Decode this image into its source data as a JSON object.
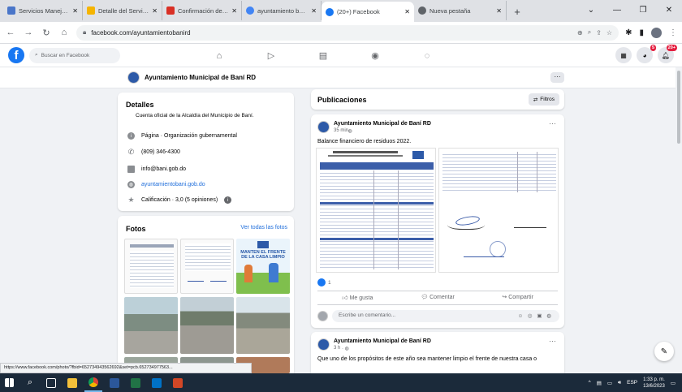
{
  "browser": {
    "tabs": [
      {
        "title": "Servicios Manejo Resi",
        "favicon_color": "#4a76c9"
      },
      {
        "title": "Detalle del Servicio y",
        "favicon_color": "#f5b400"
      },
      {
        "title": "Confirmación de carg",
        "favicon_color": "#d93025"
      },
      {
        "title": "ayuntamiento bani - Busc",
        "favicon_color": "#4285f4"
      },
      {
        "title": "(20+) Facebook",
        "favicon_color": "#1877f2"
      },
      {
        "title": "Nueva pestaña",
        "favicon_color": "#5f6368"
      }
    ],
    "new_tab": "+",
    "url": "facebook.com/ayuntamientobanird",
    "status_url": "https://www.facebook.com/photo/?fbid=652734943562692&set=pcb.652734977563..."
  },
  "fb": {
    "search_placeholder": "Buscar en Facebook",
    "notifications_badge": "5",
    "messages_badge": "20+"
  },
  "page": {
    "name": "Ayuntamiento Municipal de Baní RD"
  },
  "details": {
    "title": "Detalles",
    "description": "Cuenta oficial de la Alcaldía del Municipio de Baní.",
    "category": "Página · Organización gubernamental",
    "phone": "(809) 346-4300",
    "email": "info@bani.gob.do",
    "website": "ayuntamientobani.gob.do",
    "rating": "Calificación · 3,0 (5 opiniones)"
  },
  "photos": {
    "title": "Fotos",
    "see_all": "Ver todas las fotos",
    "poster_text": "MANTEN EL FRENTE DE LA CASA LIMPIO"
  },
  "posts_section": {
    "title": "Publicaciones",
    "filters": "Filtros"
  },
  "post1": {
    "author": "Ayuntamiento Municipal de Baní RD",
    "time": "35 min",
    "text": "Balance financiero de residuos 2022.",
    "reactions": "1",
    "like": "Me gusta",
    "comment": "Comentar",
    "share": "Compartir",
    "comment_placeholder": "Escribe un comentario..."
  },
  "post2": {
    "author": "Ayuntamiento Municipal de Baní RD",
    "time": "3 h",
    "text": "Que uno de los propósitos de este año sea mantener limpio el frente de nuestra casa o"
  },
  "taskbar": {
    "language": "ESP",
    "time": "1:33 p. m.",
    "date": "13/6/2023"
  }
}
